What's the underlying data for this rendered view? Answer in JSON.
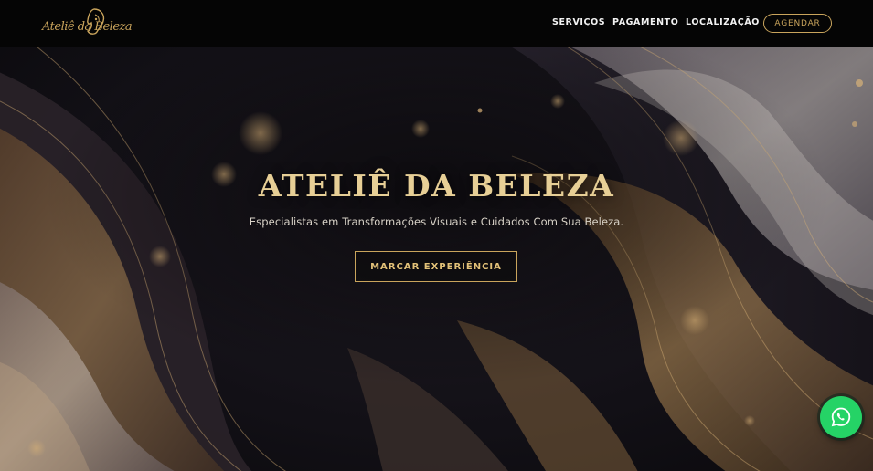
{
  "header": {
    "logo_text": "Ateliê da Beleza",
    "nav": [
      {
        "label": "SERVIÇOS"
      },
      {
        "label": "PAGAMENTO"
      },
      {
        "label": "LOCALIZAÇÃO"
      }
    ],
    "cta_label": "AGENDAR"
  },
  "hero": {
    "title": "ATELIÊ DA BELEZA",
    "subtitle": "Especialistas em Transformações Visuais e Cuidados Com Sua Beleza.",
    "button_label": "MARCAR EXPERIÊNCIA"
  },
  "floating": {
    "whatsapp_icon": "whatsapp-icon"
  },
  "colors": {
    "accent_gold": "#c9a45c",
    "title_gold": "#e7cf96",
    "header_bg": "#050505",
    "whatsapp_green": "#25d366"
  }
}
